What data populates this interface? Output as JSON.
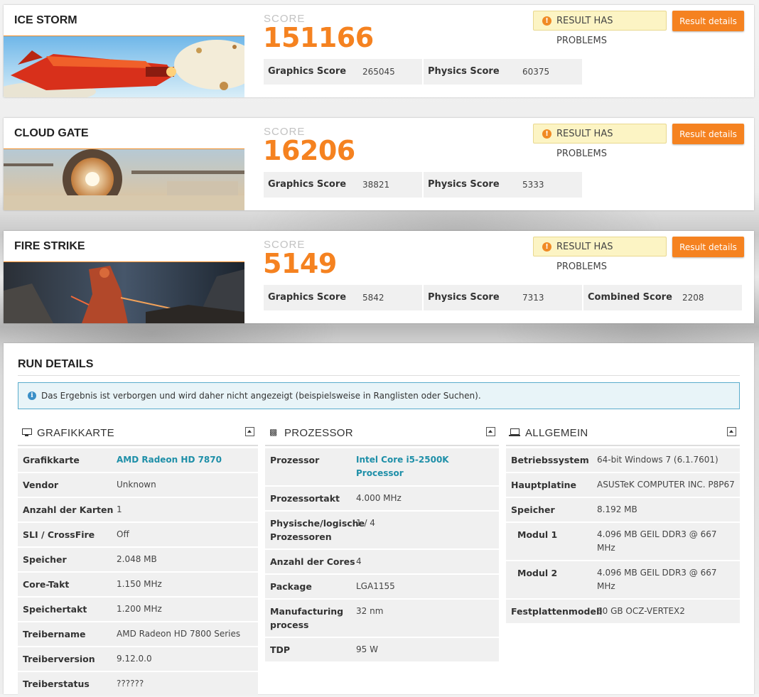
{
  "benchmarks": [
    {
      "title": "ICE STORM",
      "score_label": "SCORE",
      "score": "151166",
      "problems": "RESULT HAS PROBLEMS",
      "details_button": "Result details",
      "subscores": [
        {
          "name": "Graphics Score",
          "value": "265045"
        },
        {
          "name": "Physics Score",
          "value": "60375"
        }
      ]
    },
    {
      "title": "CLOUD GATE",
      "score_label": "SCORE",
      "score": "16206",
      "problems": "RESULT HAS PROBLEMS",
      "details_button": "Result details",
      "subscores": [
        {
          "name": "Graphics Score",
          "value": "38821"
        },
        {
          "name": "Physics Score",
          "value": "5333"
        }
      ]
    },
    {
      "title": "FIRE STRIKE",
      "score_label": "SCORE",
      "score": "5149",
      "problems": "RESULT HAS PROBLEMS",
      "details_button": "Result details",
      "subscores": [
        {
          "name": "Graphics Score",
          "value": "5842"
        },
        {
          "name": "Physics Score",
          "value": "7313"
        },
        {
          "name": "Combined Score",
          "value": "2208"
        }
      ]
    }
  ],
  "run_details": {
    "title": "RUN DETAILS",
    "info": "Das Ergebnis ist verborgen und wird daher nicht angezeigt (beispielsweise in Ranglisten oder Suchen).",
    "grafikkarte": {
      "title": "GRAFIKKARTE",
      "rows": [
        {
          "k": "Grafikkarte",
          "v": "AMD Radeon HD 7870"
        },
        {
          "k": "Vendor",
          "v": "Unknown"
        },
        {
          "k": "Anzahl der Karten",
          "v": "1"
        },
        {
          "k": "SLI / CrossFire",
          "v": "Off"
        },
        {
          "k": "Speicher",
          "v": "2.048 MB"
        },
        {
          "k": "Core-Takt",
          "v": "1.150 MHz"
        },
        {
          "k": "Speichertakt",
          "v": "1.200 MHz"
        },
        {
          "k": "Treibername",
          "v": "AMD Radeon HD 7800 Series"
        },
        {
          "k": "Treiberversion",
          "v": "9.12.0.0"
        },
        {
          "k": "Treiberstatus",
          "v": "??????"
        }
      ]
    },
    "prozessor": {
      "title": "PROZESSOR",
      "rows": [
        {
          "k": "Prozessor",
          "v": "Intel Core i5-2500K Processor"
        },
        {
          "k": "Prozessortakt",
          "v": "4.000 MHz"
        },
        {
          "k": "Physische/logische Prozessoren",
          "v": "1 / 4"
        },
        {
          "k": "Anzahl der Cores",
          "v": "4"
        },
        {
          "k": "Package",
          "v": "LGA1155"
        },
        {
          "k": "Manufacturing process",
          "v": "32 nm"
        },
        {
          "k": "TDP",
          "v": "95 W"
        }
      ]
    },
    "allgemein": {
      "title": "ALLGEMEIN",
      "rows": [
        {
          "k": "Betriebssystem",
          "v": "64-bit Windows 7 (6.1.7601)"
        },
        {
          "k": "Hauptplatine",
          "v": "ASUSTeK COMPUTER INC. P8P67"
        },
        {
          "k": "Speicher",
          "v": "8.192 MB"
        },
        {
          "k": "Modul 1",
          "v": "4.096 MB GEIL DDR3 @ 667 MHz"
        },
        {
          "k": "Modul 2",
          "v": "4.096 MB GEIL DDR3 @ 667 MHz"
        },
        {
          "k": "Festplattenmodell",
          "v": "60 GB OCZ-VERTEX2"
        }
      ]
    }
  }
}
